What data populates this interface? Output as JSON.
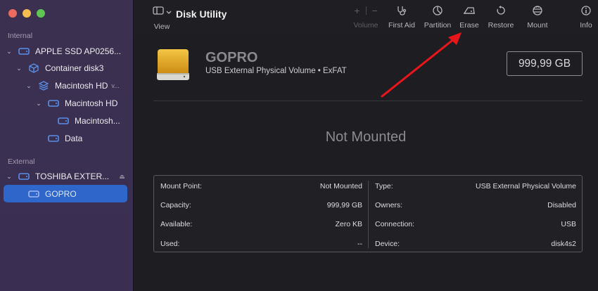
{
  "window": {
    "title": "Disk Utility"
  },
  "toolbar": {
    "view_label": "View",
    "volume_label": "Volume",
    "first_aid_label": "First Aid",
    "partition_label": "Partition",
    "erase_label": "Erase",
    "restore_label": "Restore",
    "mount_label": "Mount",
    "info_label": "Info",
    "volume_add_glyph": "+",
    "volume_remove_glyph": "−"
  },
  "sidebar": {
    "internal_label": "Internal",
    "external_label": "External",
    "items": [
      {
        "label": "APPLE SSD AP0256...",
        "icon": "disk-icon"
      },
      {
        "label": "Container disk3",
        "icon": "container-icon"
      },
      {
        "label": "Macintosh HD",
        "suffix": "v...",
        "icon": "volume-stack-icon"
      },
      {
        "label": "Macintosh HD",
        "icon": "disk-icon"
      },
      {
        "label": "Macintosh...",
        "icon": "disk-icon"
      },
      {
        "label": "Data",
        "icon": "disk-icon"
      },
      {
        "label": "TOSHIBA EXTER...",
        "icon": "disk-icon"
      },
      {
        "label": "GOPRO",
        "icon": "disk-icon"
      }
    ],
    "eject_glyph": "⏏",
    "chevron_glyph": "⌄",
    "selected_color": "#2f66c9"
  },
  "volume": {
    "name": "GOPRO",
    "subtitle": "USB External Physical Volume • ExFAT",
    "size": "999,99 GB",
    "status": "Not Mounted",
    "icon_color": "#e3a21a"
  },
  "info": {
    "left": [
      {
        "label": "Mount Point:",
        "value": "Not Mounted"
      },
      {
        "label": "Capacity:",
        "value": "999,99 GB"
      },
      {
        "label": "Available:",
        "value": "Zero KB"
      },
      {
        "label": "Used:",
        "value": "--"
      }
    ],
    "right": [
      {
        "label": "Type:",
        "value": "USB External Physical Volume"
      },
      {
        "label": "Owners:",
        "value": "Disabled"
      },
      {
        "label": "Connection:",
        "value": "USB"
      },
      {
        "label": "Device:",
        "value": "disk4s2"
      }
    ]
  },
  "colors": {
    "accent": "#2f66c9",
    "annotation_arrow": "#e8161b"
  }
}
